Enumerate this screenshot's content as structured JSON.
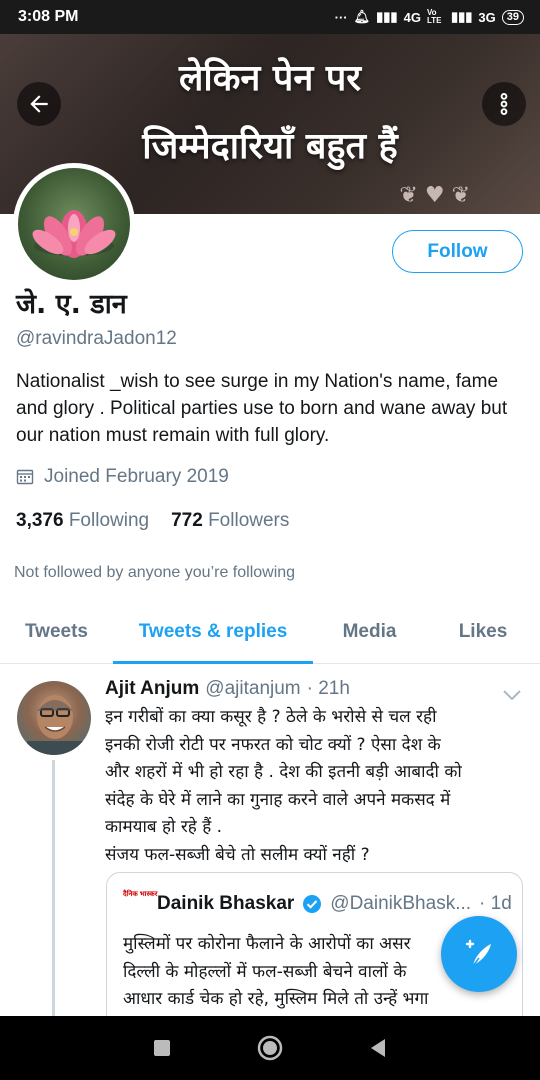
{
  "status_bar": {
    "time": "3:08 PM",
    "network_1": "4G",
    "volte": "Vo LTE",
    "network_2": "3G",
    "battery": "39"
  },
  "banner": {
    "line1": "लेकिन पेन पर",
    "line2": "जिम्मेदारियाँ बहुत हैं"
  },
  "profile": {
    "follow_label": "Follow",
    "name": "जे. ए. डान",
    "handle": "@ravindraJadon12",
    "bio": "Nationalist _wish to see surge in  my Nation's name, fame and glory . Political parties use to born and wane away but our nation must remain with full glory.",
    "joined": "Joined February 2019",
    "following_count": "3,376",
    "following_label": "Following",
    "followers_count": "772",
    "followers_label": "Followers",
    "not_followed": "Not followed by anyone you’re following"
  },
  "tabs": [
    {
      "label": "Tweets",
      "active": false
    },
    {
      "label": "Tweets & replies",
      "active": true
    },
    {
      "label": "Media",
      "active": false
    },
    {
      "label": "Likes",
      "active": false
    }
  ],
  "tweet": {
    "author": "Ajit Anjum",
    "handle": "@ajitanjum",
    "time": "· 21h",
    "text_lines": [
      "इन गरीबों का क्या कसूर है ? ठेले के भरोसे से चल रही",
      "इनकी रोजी रोटी पर नफरत को चोट क्यों ? ऐसा देश के",
      "और शहरों में भी हो रहा है . देश की इतनी बड़ी आबादी को",
      "संदेह के घेरे में लाने का गुनाह करने वाले अपने मकसद में",
      "कामयाब हो रहे हैं .",
      "संजय फल-सब्जी बेचे तो सलीम क्यों नहीं ?"
    ],
    "quote": {
      "logo_text": "दैनिक भास्कर",
      "author": "Dainik Bhaskar",
      "handle": "@DainikBhask...",
      "time": "· 1d",
      "text_lines": [
        "मुस्लिमों पर कोरोना फैलाने के आरोपों का असर",
        "दिल्ली के मोहल्लों में फल-सब्जी बेचने वालों के",
        "आधार कार्ड चेक हो रहे, मुस्लिम मिले तो उन्हें भगा"
      ]
    }
  },
  "colors": {
    "accent": "#1da1f2",
    "secondary_text": "#657786",
    "primary_text": "#14171a",
    "verified": "#1da1f2"
  },
  "icons": [
    "back-arrow-icon",
    "more-vertical-icon",
    "calendar-icon",
    "chevron-down-icon",
    "verified-badge-icon",
    "compose-tweet-icon",
    "nav-recents-icon",
    "nav-home-icon",
    "nav-back-icon"
  ]
}
